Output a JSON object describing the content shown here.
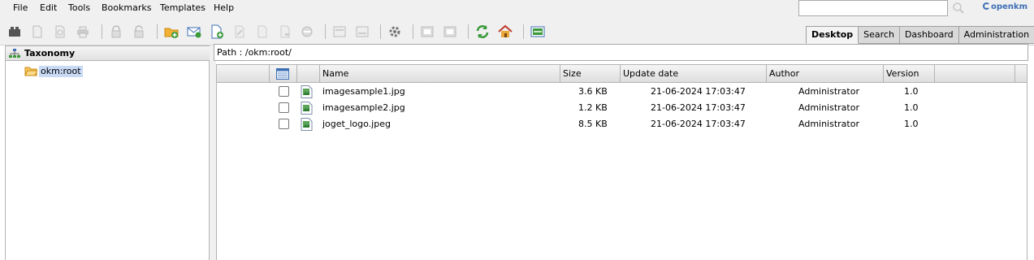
{
  "menu": [
    "File",
    "Edit",
    "Tools",
    "Bookmarks",
    "Templates",
    "Help"
  ],
  "search": {
    "value": "",
    "placeholder": ""
  },
  "logo": {
    "text": "openkm"
  },
  "tabs": [
    "Desktop",
    "Search",
    "Dashboard",
    "Administration"
  ],
  "active_tab": "Desktop",
  "taxonomy": {
    "title": "Taxonomy",
    "root": "okm:root"
  },
  "path": {
    "label": "Path : /okm:root/"
  },
  "table": {
    "columns": [
      "Name",
      "Size",
      "Update date",
      "Author",
      "Version"
    ],
    "rows": [
      {
        "name": "imagesample1.jpg",
        "size": "3.6 KB",
        "date": "21-06-2024 17:03:47",
        "author": "Administrator",
        "version": "1.0"
      },
      {
        "name": "imagesample2.jpg",
        "size": "1.2 KB",
        "date": "21-06-2024 17:03:47",
        "author": "Administrator",
        "version": "1.0"
      },
      {
        "name": "joget_logo.jpeg",
        "size": "8.5 KB",
        "date": "21-06-2024 17:03:47",
        "author": "Administrator",
        "version": "1.0"
      }
    ]
  },
  "colors": {
    "accent": "#3e6fb5",
    "selection": "#c9daf5",
    "folder": "#f2b134",
    "green": "#3a9a3a"
  },
  "toolbar_icons": [
    "bookmark-icon",
    "add-document-icon",
    "pdf-icon",
    "print-icon",
    "lock-icon",
    "unlock-icon",
    "new-folder-icon",
    "new-mail-icon",
    "new-document-icon",
    "edit-document-icon",
    "checkout-icon",
    "cancel-checkout-icon",
    "delete-icon",
    "add-property-group-icon",
    "remove-property-group-icon",
    "workflow-icon",
    "add-subscription-icon",
    "remove-subscription-icon",
    "refresh-icon",
    "home-icon",
    "split-view-icon"
  ]
}
